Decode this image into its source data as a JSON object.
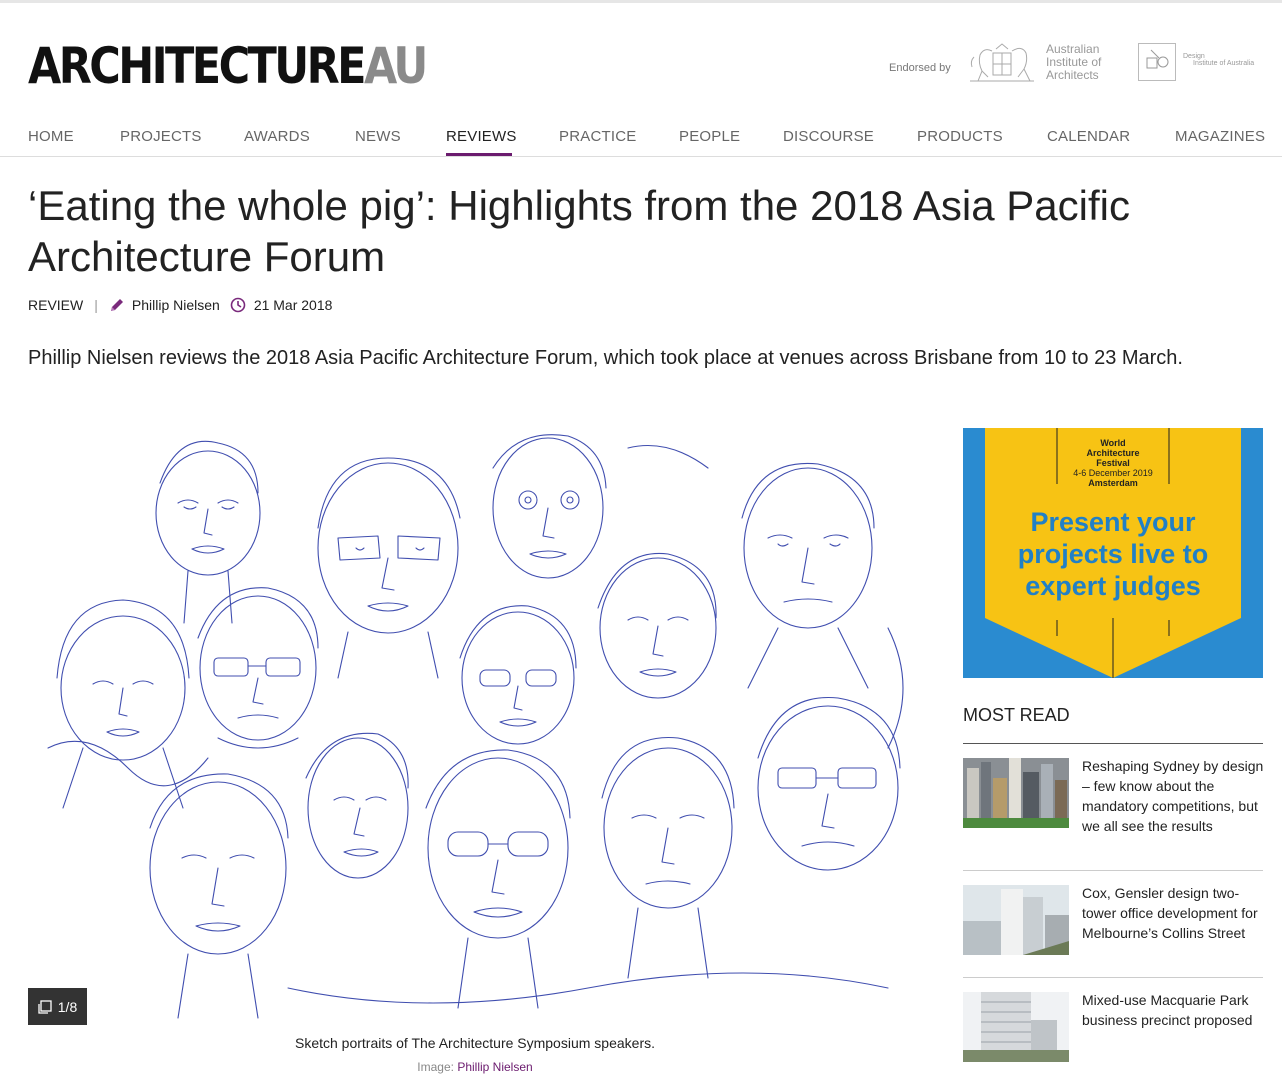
{
  "brand": {
    "logo_main": "ARCHITECTURE",
    "logo_suffix": "AU"
  },
  "endorsement": {
    "label": "Endorsed by",
    "aia_line1": "Australian",
    "aia_line2": "Institute of",
    "aia_line3": "Architects",
    "di_line1": "Design",
    "di_line2": "Institute of Australia"
  },
  "nav": {
    "items": [
      {
        "label": "HOME"
      },
      {
        "label": "PROJECTS"
      },
      {
        "label": "AWARDS"
      },
      {
        "label": "NEWS"
      },
      {
        "label": "REVIEWS"
      },
      {
        "label": "PRACTICE"
      },
      {
        "label": "PEOPLE"
      },
      {
        "label": "DISCOURSE"
      },
      {
        "label": "PRODUCTS"
      },
      {
        "label": "CALENDAR"
      },
      {
        "label": "MAGAZINES"
      }
    ],
    "active": "REVIEWS"
  },
  "article": {
    "title": "‘Eating the whole pig’: Highlights from the 2018 Asia Pacific Architecture Forum",
    "category": "REVIEW",
    "separator": "|",
    "author": "Phillip Nielsen",
    "date": "21 Mar 2018",
    "standfirst": "Phillip Nielsen reviews the 2018 Asia Pacific Architecture Forum, which took place at venues across Brisbane from 10 to 23 March."
  },
  "gallery": {
    "counter": "1/8",
    "caption": "Sketch portraits of The Architecture Symposium speakers.",
    "credit_label": "Image:",
    "credit_name": "Phillip Nielsen"
  },
  "ad": {
    "event_line1": "World",
    "event_line2": "Architecture",
    "event_line3": "Festival",
    "event_line4": "4-6 December 2019",
    "event_line5": "Amsterdam",
    "headline_line1": "Present your",
    "headline_line2": "projects live to",
    "headline_line3": "expert judges"
  },
  "most_read": {
    "title": "MOST READ",
    "items": [
      {
        "text": "Reshaping Sydney by design – few know about the mandatory competitions, but we all see the results"
      },
      {
        "text": "Cox, Gensler design two-tower office development for Melbourne’s Collins Street"
      },
      {
        "text": "Mixed-use Macquarie Park business precinct proposed"
      }
    ]
  },
  "colors": {
    "accent": "#6b1b6e",
    "ad_blue": "#2a8bd0",
    "ad_yellow": "#f7c314",
    "sketch_ink": "#2b3aa6"
  }
}
